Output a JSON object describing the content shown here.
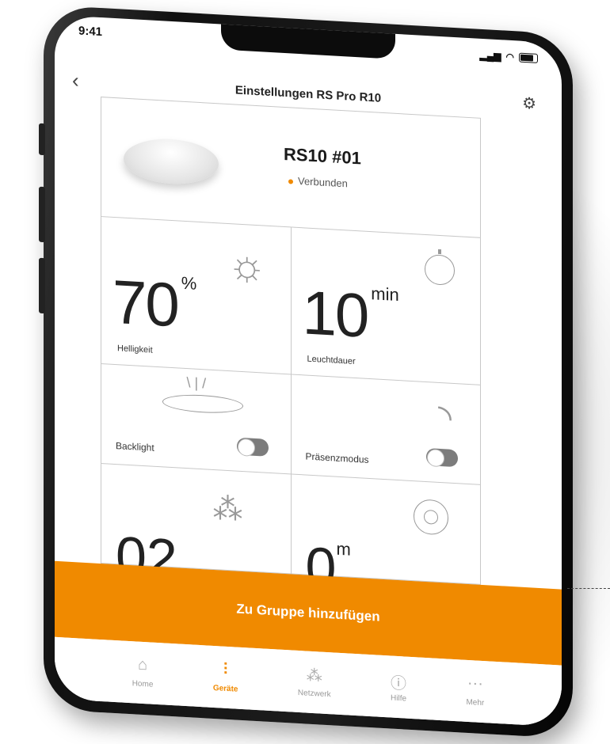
{
  "status_bar": {
    "time": "9:41"
  },
  "header": {
    "title": "Einstellungen RS Pro R10"
  },
  "device": {
    "name": "RS10 #01",
    "status": "Verbunden"
  },
  "tiles": {
    "brightness": {
      "value": "70",
      "unit": "%",
      "label": "Helligkeit"
    },
    "duration": {
      "value": "10",
      "unit": "min",
      "label": "Leuchtdauer"
    },
    "backlight": {
      "label": "Backlight",
      "on": false
    },
    "presence": {
      "label": "Präsenzmodus",
      "on": false
    },
    "network_count": {
      "value": "02"
    },
    "range": {
      "value": "0",
      "unit": "m"
    }
  },
  "cta": {
    "label": "Zu Gruppe hinzufügen"
  },
  "tabbar": {
    "items": [
      {
        "label": "Home",
        "icon": "home-icon"
      },
      {
        "label": "Geräte",
        "icon": "devices-icon",
        "active": true
      },
      {
        "label": "Netzwerk",
        "icon": "network-icon"
      },
      {
        "label": "Hilfe",
        "icon": "help-icon"
      },
      {
        "label": "Mehr",
        "icon": "more-icon"
      }
    ]
  },
  "colors": {
    "accent": "#f08a00",
    "frame": "#111111"
  }
}
